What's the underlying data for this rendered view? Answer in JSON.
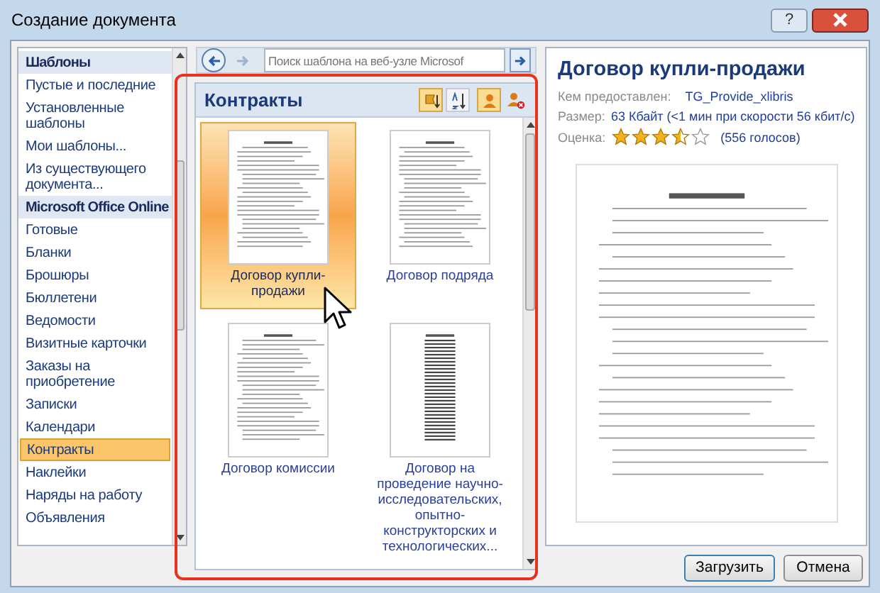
{
  "window": {
    "title": "Создание документа",
    "help_label": "?"
  },
  "sidebar": {
    "items": [
      {
        "kind": "header",
        "label": "Шаблоны",
        "selected": false
      },
      {
        "kind": "item",
        "label": "Пустые и последние",
        "selected": false
      },
      {
        "kind": "item",
        "label": "Установленные шаблоны",
        "selected": false
      },
      {
        "kind": "item",
        "label": "Мои шаблоны...",
        "selected": false
      },
      {
        "kind": "item",
        "label": "Из существующего документа...",
        "selected": false
      },
      {
        "kind": "header",
        "label": "Microsoft Office Online",
        "selected": false
      },
      {
        "kind": "item",
        "label": "Готовые",
        "selected": false
      },
      {
        "kind": "item",
        "label": "Бланки",
        "selected": false
      },
      {
        "kind": "item",
        "label": "Брошюры",
        "selected": false
      },
      {
        "kind": "item",
        "label": "Бюллетени",
        "selected": false
      },
      {
        "kind": "item",
        "label": "Ведомости",
        "selected": false
      },
      {
        "kind": "item",
        "label": "Визитные карточки",
        "selected": false
      },
      {
        "kind": "item",
        "label": "Заказы на приобретение",
        "selected": false
      },
      {
        "kind": "item",
        "label": "Записки",
        "selected": false
      },
      {
        "kind": "item",
        "label": "Календари",
        "selected": false
      },
      {
        "kind": "item",
        "label": "Контракты",
        "selected": true
      },
      {
        "kind": "item",
        "label": "Наклейки",
        "selected": false
      },
      {
        "kind": "item",
        "label": "Наряды на работу",
        "selected": false
      },
      {
        "kind": "item",
        "label": "Объявления",
        "selected": false
      }
    ]
  },
  "search": {
    "placeholder": "Поиск шаблона на веб-узле Microsof"
  },
  "gallery": {
    "title": "Контракты",
    "items": [
      {
        "label": "Договор купли-продажи",
        "selected": true
      },
      {
        "label": "Договор подряда",
        "selected": false
      },
      {
        "label": "Договор комиссии",
        "selected": false
      },
      {
        "label": "Договор на проведение научно-исследовательских, опытно-конструкторских и технологических...",
        "selected": false
      }
    ]
  },
  "details": {
    "title": "Договор купли-продажи",
    "fields": [
      {
        "kind": "link",
        "label": "Кем предоставлен:",
        "value": "TG_Provide_xlibris"
      },
      {
        "kind": "text",
        "label": "Размер:",
        "value": "63 Кбайт (<1 мин при скорости 56 кбит/с)"
      },
      {
        "kind": "rating",
        "label": "Оценка:",
        "stars": 3.5,
        "value": "(556 голосов)"
      }
    ]
  },
  "buttons": [
    {
      "label": "Загрузить",
      "default": true
    },
    {
      "label": "Отмена",
      "default": false
    }
  ]
}
